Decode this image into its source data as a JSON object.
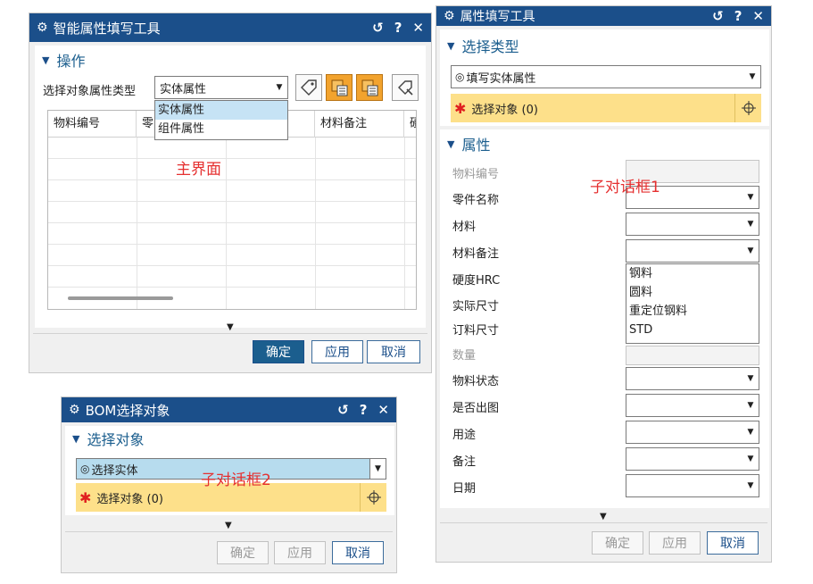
{
  "main_dialog": {
    "title": "智能属性填写工具",
    "section_title": "操作",
    "type_label": "选择对象属性类型",
    "type_value": "实体属性",
    "type_options": [
      "实体属性",
      "组件属性"
    ],
    "columns": [
      "物料编号",
      "零",
      "",
      "材料备注",
      "硬"
    ],
    "annotation": "主界面",
    "buttons": {
      "ok": "确定",
      "apply": "应用",
      "cancel": "取消"
    },
    "icons": [
      "tag-icon",
      "sheet-edit-icon",
      "sheet-import-icon",
      "select-tag-icon"
    ]
  },
  "sub_dialog_1": {
    "title": "属性填写工具",
    "select_type_title": "选择类型",
    "fill_type_value": "填写实体属性",
    "select_object": "选择对象 (0)",
    "attributes_title": "属性",
    "fields": [
      {
        "label": "物料编号",
        "kind": "text",
        "disabled": true
      },
      {
        "label": "零件名称",
        "kind": "combo"
      },
      {
        "label": "材料",
        "kind": "combo"
      },
      {
        "label": "材料备注",
        "kind": "combo"
      },
      {
        "label": "硬度HRC",
        "kind": "none"
      },
      {
        "label": "实际尺寸",
        "kind": "none"
      },
      {
        "label": "订料尺寸",
        "kind": "none"
      },
      {
        "label": "数量",
        "kind": "text",
        "disabled": true
      },
      {
        "label": "物料状态",
        "kind": "combo"
      },
      {
        "label": "是否出图",
        "kind": "combo"
      },
      {
        "label": "用途",
        "kind": "combo"
      },
      {
        "label": "备注",
        "kind": "combo"
      },
      {
        "label": "日期",
        "kind": "combo"
      }
    ],
    "material_note_options": [
      "钢料",
      "圆料",
      "重定位钢料",
      "STD"
    ],
    "annotation": "子对话框1",
    "buttons": {
      "ok": "确定",
      "apply": "应用",
      "cancel": "取消"
    }
  },
  "sub_dialog_2": {
    "title": "BOM选择对象",
    "section_title": "选择对象",
    "select_value": "选择实体",
    "select_object": "选择对象 (0)",
    "annotation": "子对话框2",
    "buttons": {
      "ok": "确定",
      "apply": "应用",
      "cancel": "取消"
    }
  },
  "titlebar_icons": {
    "reset": "↺",
    "help": "?",
    "close": "✕",
    "settings": "⚙"
  }
}
